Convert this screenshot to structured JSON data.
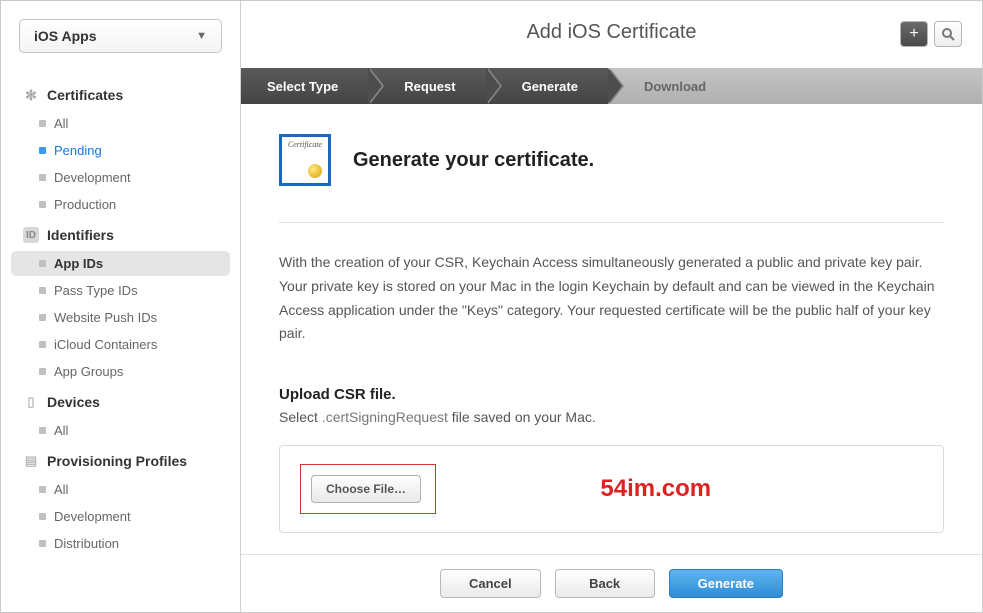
{
  "sidebar": {
    "selector_label": "iOS Apps",
    "sections": [
      {
        "title": "Certificates",
        "icon": "gear",
        "items": [
          {
            "label": "All",
            "state": ""
          },
          {
            "label": "Pending",
            "state": "selected-blue"
          },
          {
            "label": "Development",
            "state": ""
          },
          {
            "label": "Production",
            "state": ""
          }
        ]
      },
      {
        "title": "Identifiers",
        "icon": "id",
        "items": [
          {
            "label": "App IDs",
            "state": "active"
          },
          {
            "label": "Pass Type IDs",
            "state": ""
          },
          {
            "label": "Website Push IDs",
            "state": ""
          },
          {
            "label": "iCloud Containers",
            "state": ""
          },
          {
            "label": "App Groups",
            "state": ""
          }
        ]
      },
      {
        "title": "Devices",
        "icon": "device",
        "items": [
          {
            "label": "All",
            "state": ""
          }
        ]
      },
      {
        "title": "Provisioning Profiles",
        "icon": "prov",
        "items": [
          {
            "label": "All",
            "state": ""
          },
          {
            "label": "Development",
            "state": ""
          },
          {
            "label": "Distribution",
            "state": ""
          }
        ]
      }
    ]
  },
  "header": {
    "title": "Add iOS Certificate",
    "add_icon": "+",
    "search_icon": "search"
  },
  "steps": [
    {
      "label": "Select Type",
      "style": "dark"
    },
    {
      "label": "Request",
      "style": "dark"
    },
    {
      "label": "Generate",
      "style": "dark"
    },
    {
      "label": "Download",
      "style": "light"
    }
  ],
  "content": {
    "cert_badge_text": "Certificate",
    "heading": "Generate your certificate.",
    "description": "With the creation of your CSR, Keychain Access simultaneously generated a public and private key pair. Your private key is stored on your Mac in the login Keychain by default and can be viewed in the Keychain Access application under the \"Keys\" category. Your requested certificate will be the public half of your key pair.",
    "upload_title": "Upload CSR file.",
    "upload_prefix": "Select ",
    "upload_ext": ".certSigningRequest",
    "upload_suffix": " file saved on your Mac.",
    "choose_file_label": "Choose File…",
    "watermark": "54im.com"
  },
  "footer": {
    "cancel": "Cancel",
    "back": "Back",
    "generate": "Generate"
  }
}
